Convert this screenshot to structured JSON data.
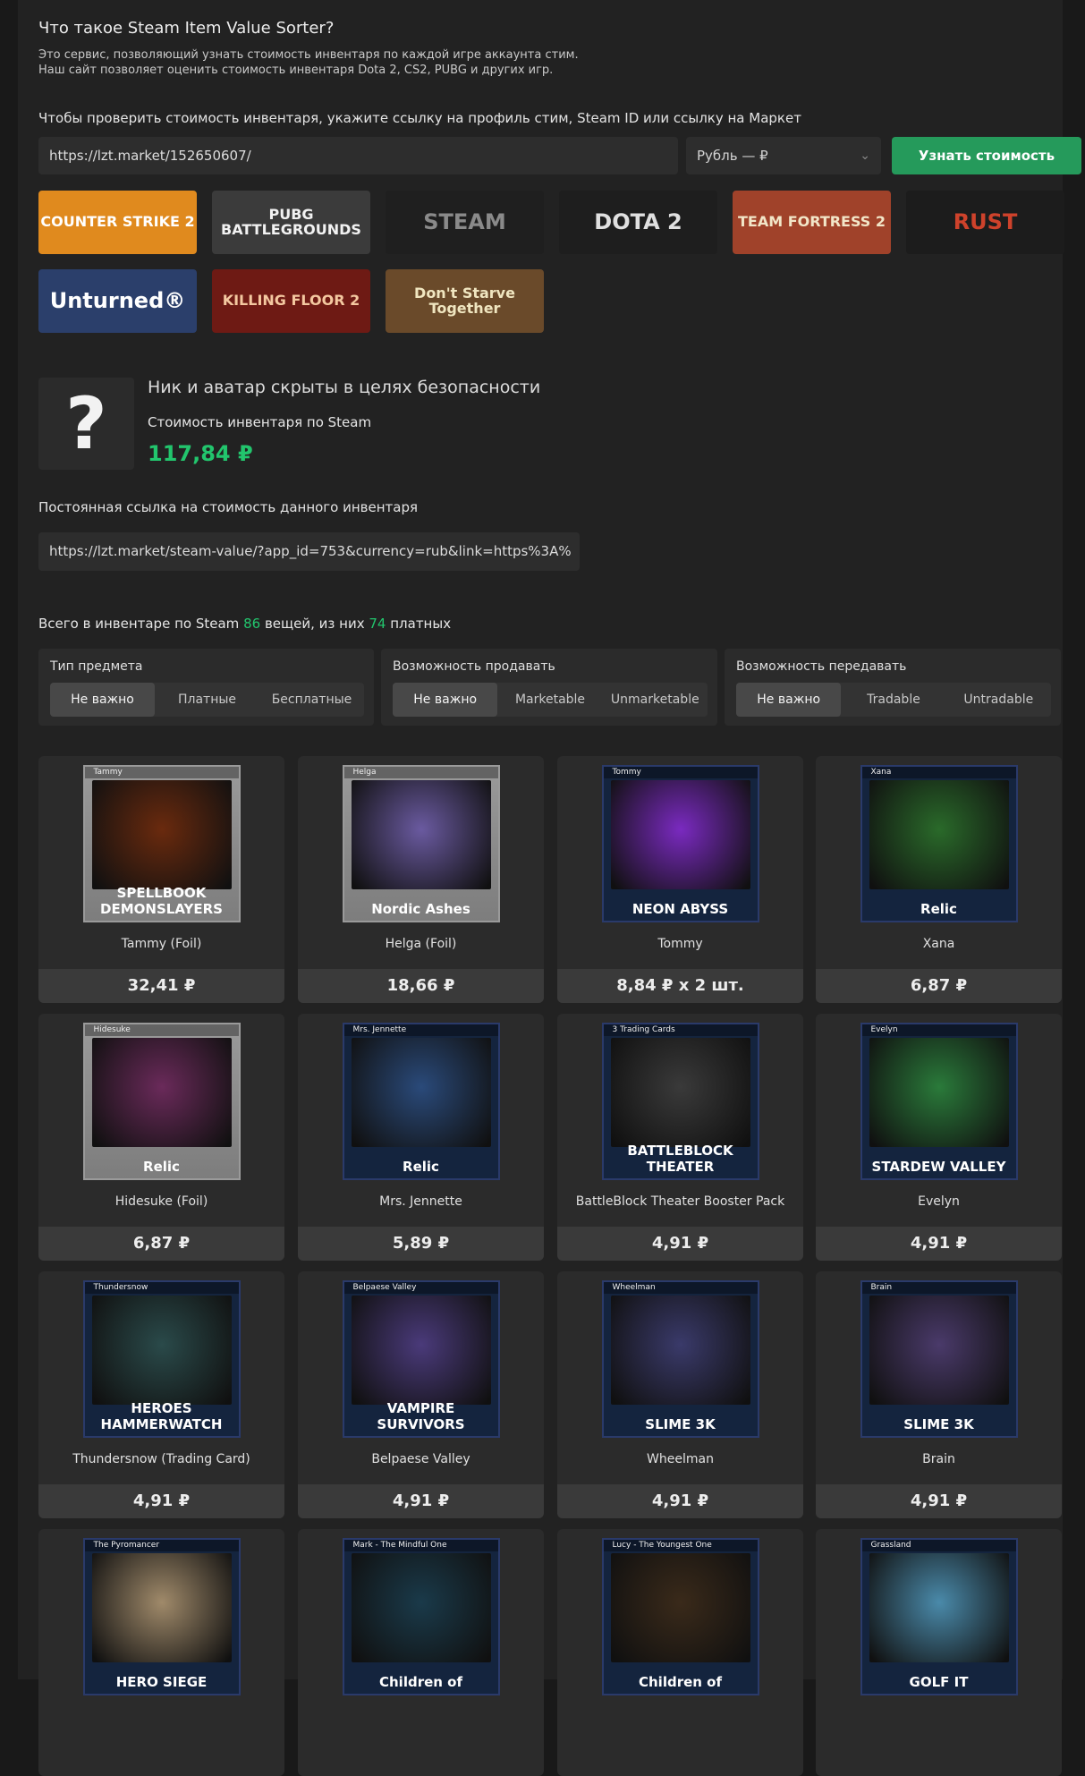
{
  "header": {
    "title": "Что такое Steam Item Value Sorter?",
    "desc_line1": "Это сервис, позволяющий узнать стоимость инвентаря по каждой игре аккаунта стим.",
    "desc_line2": "Наш сайт позволяет оценить стоимость инвентаря Dota 2, CS2, PUBG и других игр."
  },
  "form": {
    "prompt": "Чтобы проверить стоимость инвентаря, укажите ссылку на профиль стим, Steam ID или ссылку на Маркет",
    "link_value": "https://lzt.market/152650607/",
    "currency": "Рубль — ₽",
    "submit_label": "Узнать стоимость"
  },
  "games": [
    {
      "label": "COUNTER STRIKE 2",
      "bg": "#e08a1e",
      "fg": "#ffffff"
    },
    {
      "label": "PUBG BATTLEGROUNDS",
      "bg": "#3b3b3b",
      "fg": "#f2f2f2"
    },
    {
      "label": "STEAM",
      "bg": "#1f1f1f",
      "fg": "#8a8a8a"
    },
    {
      "label": "DOTA 2",
      "bg": "#1e1e1e",
      "fg": "#e0e0e0"
    },
    {
      "label": "TEAM FORTRESS 2",
      "bg": "#a0422a",
      "fg": "#f2e6c8"
    },
    {
      "label": "RUST",
      "bg": "#1c1c1c",
      "fg": "#ce422b"
    },
    {
      "label": "Unturned®",
      "bg": "#2b3f6b",
      "fg": "#ffffff"
    },
    {
      "label": "KILLING FLOOR 2",
      "bg": "#6e1a14",
      "fg": "#f4c8a0"
    },
    {
      "label": "Don't Starve Together",
      "bg": "#6a4a2a",
      "fg": "#f0e6c0"
    }
  ],
  "profile": {
    "avatar_glyph": "?",
    "nick": "Ник и аватар скрыты в целях безопасности",
    "inventory_label": "Стоимость инвентаря по Steam",
    "inventory_price": "117,84 ₽"
  },
  "permalink": {
    "label": "Постоянная ссылка на стоимость данного инвентаря",
    "value": "https://lzt.market/steam-value/?app_id=753&currency=rub&link=https%3A%"
  },
  "totals": {
    "prefix": "Всего в инвентаре по Steam",
    "count": "86",
    "middle": "вещей, из них",
    "paid": "74",
    "suffix": "платных"
  },
  "filters": [
    {
      "title": "Тип предмета",
      "options": [
        "Не важно",
        "Платные",
        "Бесплатные"
      ],
      "active": 0
    },
    {
      "title": "Возможность продавать",
      "options": [
        "Не важно",
        "Marketable",
        "Unmarketable"
      ],
      "active": 0
    },
    {
      "title": "Возможность передавать",
      "options": [
        "Не важно",
        "Tradable",
        "Untradable"
      ],
      "active": 0
    }
  ],
  "items": [
    {
      "card_label": "Tammy",
      "brand": "SPELLBOOK DEMONSLAYERS",
      "name": "Tammy (Foil)",
      "price": "32,41 ₽",
      "foil": true,
      "accent": "#6a2a0e"
    },
    {
      "card_label": "Helga",
      "brand": "Nordic Ashes",
      "name": "Helga (Foil)",
      "price": "18,66 ₽",
      "foil": true,
      "accent": "#6a5aa0"
    },
    {
      "card_label": "Tommy",
      "brand": "NEON ABYSS",
      "name": "Tommy",
      "price": "8,84 ₽ x 2 шт.",
      "foil": false,
      "accent": "#7a2ac0"
    },
    {
      "card_label": "Xana",
      "brand": "Relic",
      "name": "Xana",
      "price": "6,87 ₽",
      "foil": false,
      "accent": "#2a6a2a"
    },
    {
      "card_label": "Hidesuke",
      "brand": "Relic",
      "name": "Hidesuke (Foil)",
      "price": "6,87 ₽",
      "foil": true,
      "accent": "#6a2a5a"
    },
    {
      "card_label": "Mrs. Jennette",
      "brand": "Relic",
      "name": "Mrs. Jennette",
      "price": "5,89 ₽",
      "foil": false,
      "accent": "#2a4a7a"
    },
    {
      "card_label": "3 Trading Cards",
      "brand": "BATTLEBLOCK THEATER",
      "name": "BattleBlock Theater Booster Pack",
      "price": "4,91 ₽",
      "foil": false,
      "accent": "#3a3a3a"
    },
    {
      "card_label": "Evelyn",
      "brand": "STARDEW VALLEY",
      "name": "Evelyn",
      "price": "4,91 ₽",
      "foil": false,
      "accent": "#2a7a3a"
    },
    {
      "card_label": "Thundersnow",
      "brand": "HEROES HAMMERWATCH",
      "name": "Thundersnow (Trading Card)",
      "price": "4,91 ₽",
      "foil": false,
      "accent": "#2a4a4a"
    },
    {
      "card_label": "Belpaese Valley",
      "brand": "VAMPIRE SURVIVORS",
      "name": "Belpaese Valley",
      "price": "4,91 ₽",
      "foil": false,
      "accent": "#4a3a7a"
    },
    {
      "card_label": "Wheelman",
      "brand": "SLIME 3K",
      "name": "Wheelman",
      "price": "4,91 ₽",
      "foil": false,
      "accent": "#3a3a6a"
    },
    {
      "card_label": "Brain",
      "brand": "SLIME 3K",
      "name": "Brain",
      "price": "4,91 ₽",
      "foil": false,
      "accent": "#4a3a6a"
    },
    {
      "card_label": "The Pyromancer",
      "brand": "HERO SIEGE",
      "name": "",
      "price": "",
      "foil": false,
      "accent": "#a08a6a"
    },
    {
      "card_label": "Mark - The Mindful One",
      "brand": "Children of",
      "name": "",
      "price": "",
      "foil": false,
      "accent": "#1a3a4a"
    },
    {
      "card_label": "Lucy - The Youngest One",
      "brand": "Children of",
      "name": "",
      "price": "",
      "foil": false,
      "accent": "#3a2a1a"
    },
    {
      "card_label": "Grassland",
      "brand": "GOLF IT",
      "name": "",
      "price": "",
      "foil": false,
      "accent": "#4a8aaa"
    }
  ]
}
